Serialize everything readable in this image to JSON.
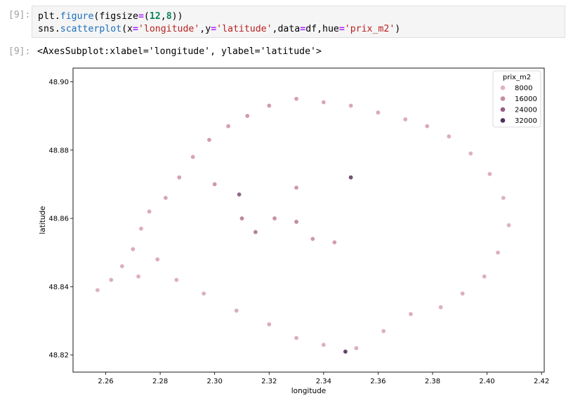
{
  "cell": {
    "in_prompt": "[9]:",
    "out_prompt": "[9]:",
    "code_lines": [
      [
        {
          "t": "plt.",
          "c": "plain"
        },
        {
          "t": "figure",
          "c": "kw-fn"
        },
        {
          "t": "(figsize",
          "c": "plain"
        },
        {
          "t": "=",
          "c": "op"
        },
        {
          "t": "(",
          "c": "plain"
        },
        {
          "t": "12",
          "c": "num"
        },
        {
          "t": ",",
          "c": "plain"
        },
        {
          "t": "8",
          "c": "num"
        },
        {
          "t": "))",
          "c": "plain"
        }
      ],
      [
        {
          "t": "sns.",
          "c": "plain"
        },
        {
          "t": "scatterplot",
          "c": "kw-fn"
        },
        {
          "t": "(x",
          "c": "plain"
        },
        {
          "t": "=",
          "c": "op"
        },
        {
          "t": "'longitude'",
          "c": "str"
        },
        {
          "t": ",y",
          "c": "plain"
        },
        {
          "t": "=",
          "c": "op"
        },
        {
          "t": "'latitude'",
          "c": "str"
        },
        {
          "t": ",data",
          "c": "plain"
        },
        {
          "t": "=",
          "c": "op"
        },
        {
          "t": "df,hue",
          "c": "plain"
        },
        {
          "t": "=",
          "c": "op"
        },
        {
          "t": "'prix_m2'",
          "c": "str"
        },
        {
          "t": ")",
          "c": "plain"
        }
      ]
    ],
    "output_text": "<AxesSubplot:xlabel='longitude', ylabel='latitude'>"
  },
  "chart_data": {
    "type": "scatter",
    "xlabel": "longitude",
    "ylabel": "latitude",
    "xlim": [
      2.248,
      2.421
    ],
    "ylim": [
      48.815,
      48.904
    ],
    "xticks": [
      2.26,
      2.28,
      2.3,
      2.32,
      2.34,
      2.36,
      2.38,
      2.4,
      2.42
    ],
    "yticks": [
      48.82,
      48.84,
      48.86,
      48.88,
      48.9
    ],
    "xtick_labels": [
      "2.26",
      "2.28",
      "2.30",
      "2.32",
      "2.34",
      "2.36",
      "2.38",
      "2.40",
      "2.42"
    ],
    "ytick_labels": [
      "48.82",
      "48.84",
      "48.86",
      "48.88",
      "48.90"
    ],
    "grid": false,
    "legend": {
      "title": "prix_m2",
      "placement": "top-right",
      "entries": [
        {
          "label": "8000",
          "value": 8000,
          "color": "#e2b2bf"
        },
        {
          "label": "16000",
          "value": 16000,
          "color": "#c98aa3"
        },
        {
          "label": "24000",
          "value": 24000,
          "color": "#9b5a85"
        },
        {
          "label": "32000",
          "value": 32000,
          "color": "#4f2f5e"
        }
      ]
    },
    "colors": {
      "low": "#e8c3ca",
      "mid": "#cf97ab",
      "high": "#3f2a57"
    },
    "series": [
      {
        "name": "prix_m2",
        "points": [
          [
            2.257,
            48.839,
            9000
          ],
          [
            2.262,
            48.842,
            10000
          ],
          [
            2.266,
            48.846,
            9500
          ],
          [
            2.27,
            48.851,
            10500
          ],
          [
            2.273,
            48.857,
            9800
          ],
          [
            2.276,
            48.862,
            11000
          ],
          [
            2.282,
            48.866,
            12000
          ],
          [
            2.287,
            48.872,
            13000
          ],
          [
            2.292,
            48.878,
            12500
          ],
          [
            2.298,
            48.883,
            14000
          ],
          [
            2.305,
            48.887,
            13500
          ],
          [
            2.312,
            48.89,
            15000
          ],
          [
            2.32,
            48.893,
            14500
          ],
          [
            2.33,
            48.895,
            13000
          ],
          [
            2.34,
            48.894,
            12000
          ],
          [
            2.35,
            48.893,
            11500
          ],
          [
            2.36,
            48.891,
            11000
          ],
          [
            2.37,
            48.889,
            10500
          ],
          [
            2.378,
            48.887,
            11000
          ],
          [
            2.386,
            48.884,
            10000
          ],
          [
            2.394,
            48.879,
            9500
          ],
          [
            2.401,
            48.873,
            9800
          ],
          [
            2.406,
            48.866,
            9200
          ],
          [
            2.408,
            48.858,
            9000
          ],
          [
            2.404,
            48.85,
            9500
          ],
          [
            2.399,
            48.843,
            9800
          ],
          [
            2.391,
            48.838,
            10000
          ],
          [
            2.383,
            48.834,
            9500
          ],
          [
            2.372,
            48.832,
            9800
          ],
          [
            2.362,
            48.827,
            10000
          ],
          [
            2.352,
            48.822,
            9200
          ],
          [
            2.34,
            48.823,
            9500
          ],
          [
            2.33,
            48.825,
            10200
          ],
          [
            2.32,
            48.829,
            10800
          ],
          [
            2.308,
            48.833,
            10000
          ],
          [
            2.296,
            48.838,
            9500
          ],
          [
            2.286,
            48.842,
            9800
          ],
          [
            2.279,
            48.848,
            10500
          ],
          [
            2.272,
            48.843,
            9300
          ],
          [
            2.3,
            48.87,
            15500
          ],
          [
            2.31,
            48.86,
            18000
          ],
          [
            2.315,
            48.856,
            19500
          ],
          [
            2.322,
            48.86,
            16500
          ],
          [
            2.33,
            48.859,
            17500
          ],
          [
            2.336,
            48.854,
            15000
          ],
          [
            2.344,
            48.853,
            14000
          ],
          [
            2.33,
            48.869,
            15000
          ],
          [
            2.35,
            48.872,
            28000
          ],
          [
            2.309,
            48.867,
            24000
          ],
          [
            2.348,
            48.821,
            30000
          ]
        ]
      }
    ]
  }
}
